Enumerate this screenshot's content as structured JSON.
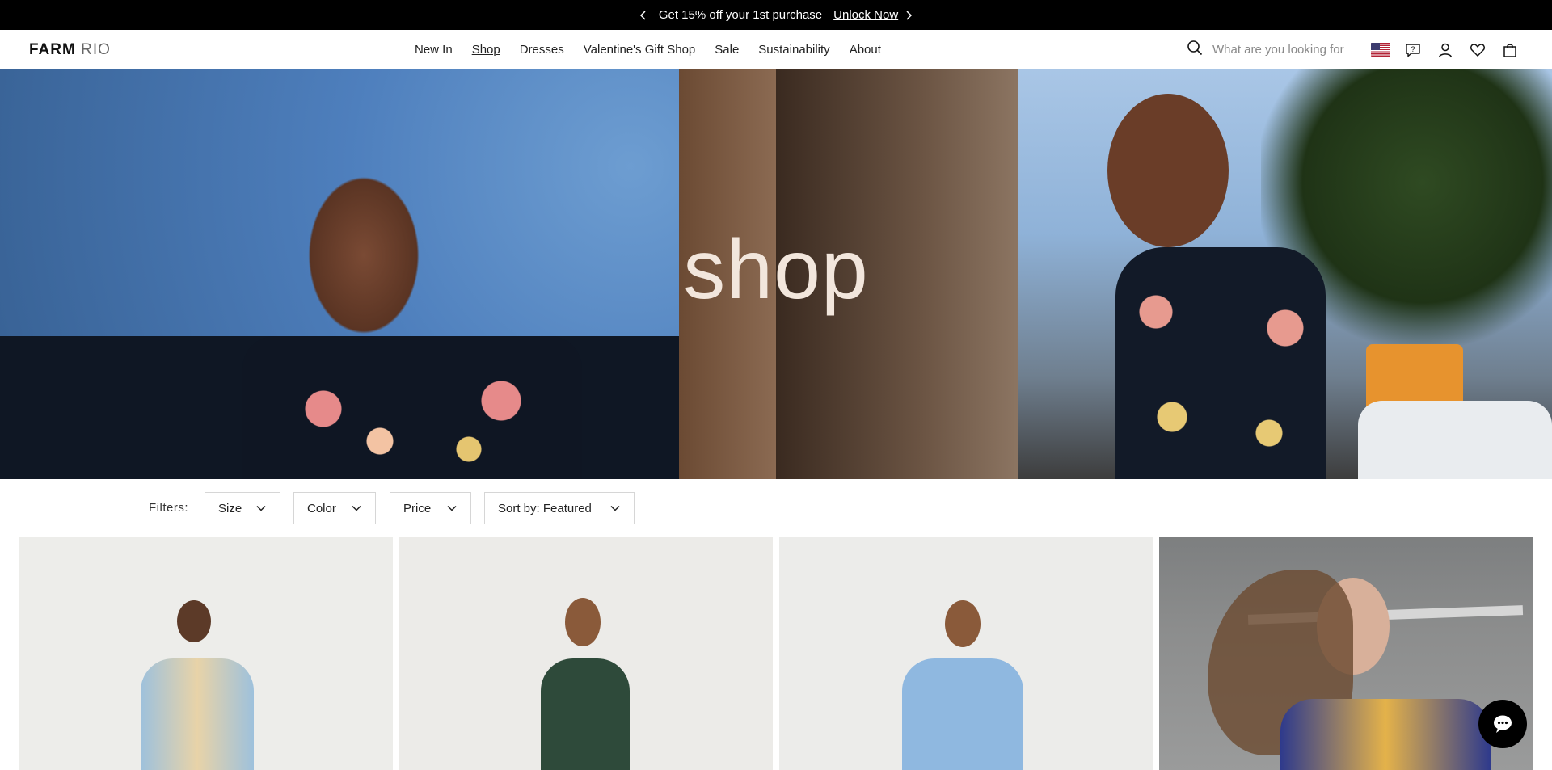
{
  "promo": {
    "message": "Get 15% off your 1st purchase",
    "link": "Unlock Now"
  },
  "header": {
    "logo_bold": "FARM",
    "logo_light": "RIO",
    "nav": [
      "New In",
      "Shop",
      "Dresses",
      "Valentine's Gift Shop",
      "Sale",
      "Sustainability",
      "About"
    ],
    "active_nav": "Shop",
    "search_placeholder": "What are you looking for"
  },
  "hero": {
    "title": "shop"
  },
  "filters": {
    "label": "Filters:",
    "buttons": [
      "Size",
      "Color",
      "Price",
      "Sort by: Featured"
    ]
  },
  "icons": {
    "promo_prev": "chevron-left-icon",
    "promo_next": "chevron-right-icon",
    "search": "search-icon",
    "flag": "us-flag-icon",
    "help": "help-chat-icon",
    "account": "user-icon",
    "wishlist": "heart-icon",
    "bag": "shopping-bag-icon",
    "chat": "chat-bubble-icon",
    "dropdown": "chevron-down-icon"
  }
}
